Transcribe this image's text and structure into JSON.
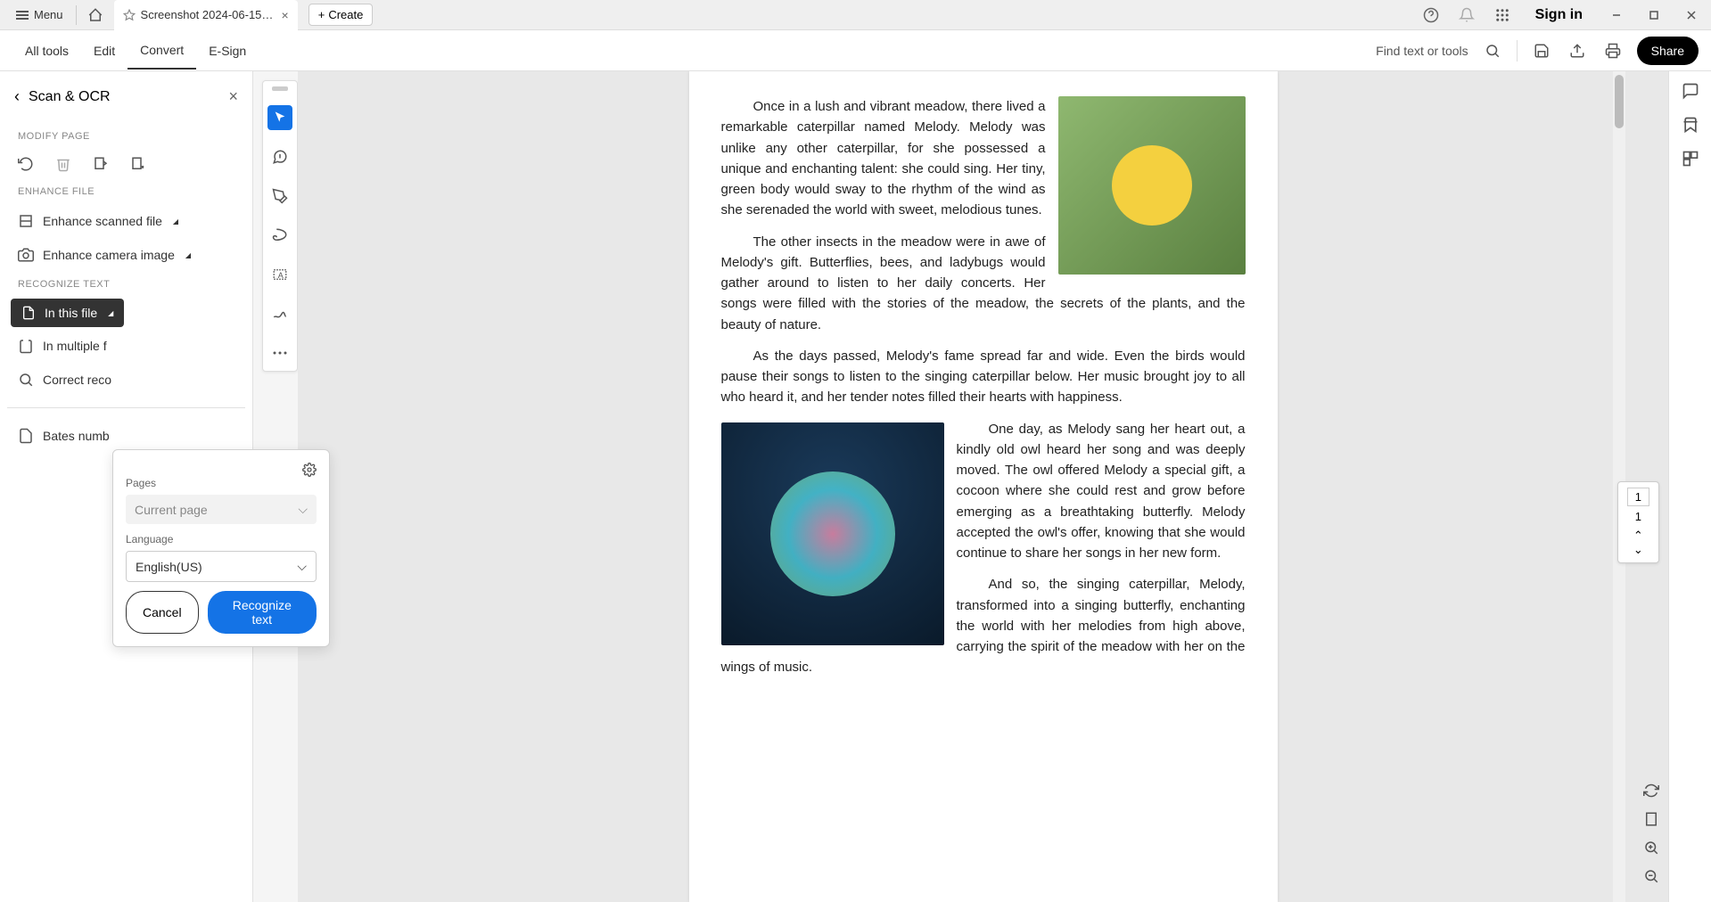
{
  "titlebar": {
    "menu_label": "Menu",
    "tab_title": "Screenshot 2024-06-15 1...",
    "create_label": "Create",
    "signin_label": "Sign in"
  },
  "menubar": {
    "items": [
      "All tools",
      "Edit",
      "Convert",
      "E-Sign"
    ],
    "find_label": "Find text or tools",
    "share_label": "Share"
  },
  "sidebar": {
    "title": "Scan & OCR",
    "section_modify": "MODIFY PAGE",
    "section_enhance": "ENHANCE FILE",
    "enhance_scanned": "Enhance scanned file",
    "enhance_camera": "Enhance camera image",
    "section_recognize": "RECOGNIZE TEXT",
    "in_this_file": "In this file",
    "in_multiple": "In multiple f",
    "correct_reco": "Correct reco",
    "bates": "Bates numb"
  },
  "popup": {
    "pages_label": "Pages",
    "pages_value": "Current page",
    "language_label": "Language",
    "language_value": "English(US)",
    "cancel": "Cancel",
    "recognize": "Recognize text"
  },
  "document": {
    "para1": "Once in a lush and vibrant meadow, there lived a remarkable caterpillar named Melody. Melody was unlike any other caterpillar, for she possessed a unique and enchanting talent: she could sing. Her tiny, green body would sway to the rhythm of the wind as she serenaded the world with sweet, melodious tunes.",
    "para2": "The other insects in the meadow were in awe of Melody's gift. Butterflies, bees, and ladybugs would gather around to listen to her daily concerts. Her songs were filled with the stories of the meadow, the secrets of the plants, and the beauty of nature.",
    "para3": "As the days passed, Melody's fame spread far and wide. Even the birds would pause their songs to listen to the singing caterpillar below. Her music brought joy to all who heard it, and her tender notes filled their hearts with happiness.",
    "para4": "One day, as Melody sang her heart out, a kindly old owl heard her song and was deeply moved. The owl offered Melody a special gift, a cocoon where she could rest and grow before emerging as a breathtaking butterfly. Melody accepted the owl's offer, knowing that she would continue to share her songs in her new form.",
    "para5": "And so, the singing caterpillar, Melody, transformed into a singing butterfly, enchanting the world with her melodies from high above, carrying the spirit of the meadow with her on the wings of music."
  },
  "pagenav": {
    "current": "1",
    "total": "1"
  }
}
